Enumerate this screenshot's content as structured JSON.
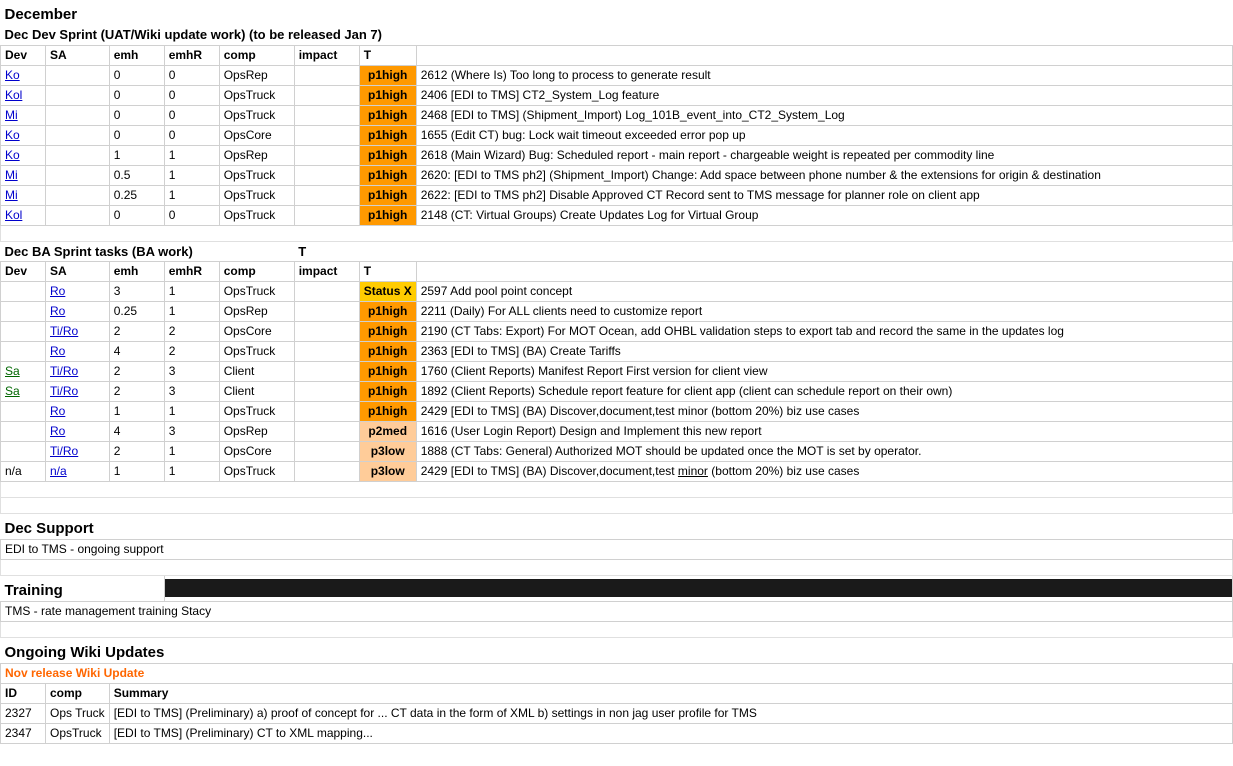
{
  "sections": {
    "december": {
      "title": "December",
      "devSprint": {
        "header": "Dec Dev Sprint  (UAT/Wiki update work) (to be released Jan 7)",
        "columns": [
          "Dev",
          "SA",
          "emh",
          "emhR",
          "comp",
          "impact",
          "T"
        ],
        "rows": [
          {
            "dev": "Ko",
            "sa": "",
            "emh": "0",
            "emhR": "0",
            "comp": "OpsRep",
            "impact": "",
            "t": "p1high",
            "desc": "2612 (Where Is) Too long to process to generate result"
          },
          {
            "dev": "Kol",
            "sa": "",
            "emh": "0",
            "emhR": "0",
            "comp": "OpsTruck",
            "impact": "",
            "t": "p1high",
            "desc": "2406 [EDI to TMS] CT2_System_Log feature"
          },
          {
            "dev": "Mi",
            "sa": "",
            "emh": "0",
            "emhR": "0",
            "comp": "OpsTruck",
            "impact": "",
            "t": "p1high",
            "desc": "2468 [EDI to TMS] (Shipment_Import) Log_101B_event_into_CT2_System_Log"
          },
          {
            "dev": "Ko",
            "sa": "",
            "emh": "0",
            "emhR": "0",
            "comp": "OpsCore",
            "impact": "",
            "t": "p1high",
            "desc": "1655 (Edit CT) bug: Lock wait timeout exceeded error pop up"
          },
          {
            "dev": "Ko",
            "sa": "",
            "emh": "1",
            "emhR": "1",
            "comp": "OpsRep",
            "impact": "",
            "t": "p1high",
            "desc": "2618 (Main Wizard) Bug: Scheduled report - main report - chargeable weight is repeated per commodity line"
          },
          {
            "dev": "Mi",
            "sa": "",
            "emh": "0.5",
            "emhR": "1",
            "comp": "OpsTruck",
            "impact": "",
            "t": "p1high",
            "desc": "2620: [EDI to TMS ph2] (Shipment_Import) Change: Add space between phone number & the extensions for origin & destination"
          },
          {
            "dev": "Mi",
            "sa": "",
            "emh": "0.25",
            "emhR": "1",
            "comp": "OpsTruck",
            "impact": "",
            "t": "p1high",
            "desc": "2622: [EDI to TMS ph2] Disable Approved CT Record sent to TMS message for planner role on client app"
          },
          {
            "dev": "Kol",
            "sa": "",
            "emh": "0",
            "emhR": "0",
            "comp": "OpsTruck",
            "impact": "",
            "t": "p1high",
            "desc": "2148 (CT: Virtual Groups) Create Updates Log for Virtual Group"
          }
        ]
      },
      "baSprint": {
        "header": "Dec BA Sprint tasks (BA work)",
        "columns": [
          "Dev",
          "SA",
          "emh",
          "emhR",
          "comp",
          "impact",
          "T"
        ],
        "rows": [
          {
            "dev": "",
            "sa": "Ro",
            "emh": "3",
            "emhR": "1",
            "comp": "OpsTruck",
            "impact": "",
            "t": "status-x",
            "desc": "2597 Add pool point concept"
          },
          {
            "dev": "",
            "sa": "Ro",
            "emh": "0.25",
            "emhR": "1",
            "comp": "OpsRep",
            "impact": "",
            "t": "p1high",
            "desc": "2211 (Daily) For ALL clients need to customize report"
          },
          {
            "dev": "",
            "sa": "Ti/Ro",
            "emh": "2",
            "emhR": "2",
            "comp": "OpsCore",
            "impact": "",
            "t": "p1high",
            "desc": "2190 (CT Tabs: Export) For MOT Ocean, add OHBL validation steps to export tab and record the same in the updates log"
          },
          {
            "dev": "",
            "sa": "Ro",
            "emh": "4",
            "emhR": "2",
            "comp": "OpsTruck",
            "impact": "",
            "t": "p1high",
            "desc": "2363 [EDI to TMS] (BA) Create Tariffs"
          },
          {
            "dev": "Sa",
            "sa": "Ti/Ro",
            "emh": "2",
            "emhR": "3",
            "comp": "Client",
            "impact": "",
            "t": "p1high",
            "desc": "1760 (Client Reports) Manifest Report First version for client view"
          },
          {
            "dev": "Sa",
            "sa": "Ti/Ro",
            "emh": "2",
            "emhR": "3",
            "comp": "Client",
            "impact": "",
            "t": "p1high",
            "desc": "1892 (Client Reports) Schedule report feature for client app (client can schedule report on their own)"
          },
          {
            "dev": "",
            "sa": "Ro",
            "emh": "1",
            "emhR": "1",
            "comp": "OpsTruck",
            "impact": "",
            "t": "p1high",
            "desc": "2429 [EDI to TMS] (BA) Discover,document,test minor (bottom 20%) biz use cases"
          },
          {
            "dev": "",
            "sa": "Ro",
            "emh": "4",
            "emhR": "3",
            "comp": "OpsRep",
            "impact": "",
            "t": "p2med",
            "desc": "1616 (User Login Report) Design and Implement this new report"
          },
          {
            "dev": "",
            "sa": "Ti/Ro",
            "emh": "2",
            "emhR": "1",
            "comp": "OpsCore",
            "impact": "",
            "t": "p3low",
            "desc": "1888 (CT Tabs: General) Authorized MOT should be updated once the MOT is set by operator."
          },
          {
            "dev": "n/a",
            "sa": "n/a",
            "emh": "1",
            "emhR": "1",
            "comp": "OpsTruck",
            "impact": "",
            "t": "p3low",
            "desc": "2429 [EDI to TMS] (BA) Discover,document,test minor (bottom 20%) biz use cases"
          }
        ]
      },
      "support": {
        "title": "Dec Support",
        "desc": "EDI to TMS - ongoing support"
      },
      "training": {
        "title": "Training",
        "desc": "TMS - rate management training Stacy"
      },
      "wikiUpdates": {
        "title": "Ongoing Wiki Updates",
        "subtitle": "Nov release Wiki Update",
        "columns": [
          "ID",
          "comp",
          "Summary"
        ],
        "rows": [
          {
            "id": "2327",
            "comp": "Ops Truck",
            "summary": "[EDI to TMS] (Preliminary) a) proof of concept for ... CT data in the form of XML b) settings in non jag user profile for TMS"
          },
          {
            "id": "2347",
            "comp": "OpsTruck",
            "summary": "[EDI to TMS] (Preliminary) CT to XML mapping..."
          }
        ]
      }
    }
  }
}
